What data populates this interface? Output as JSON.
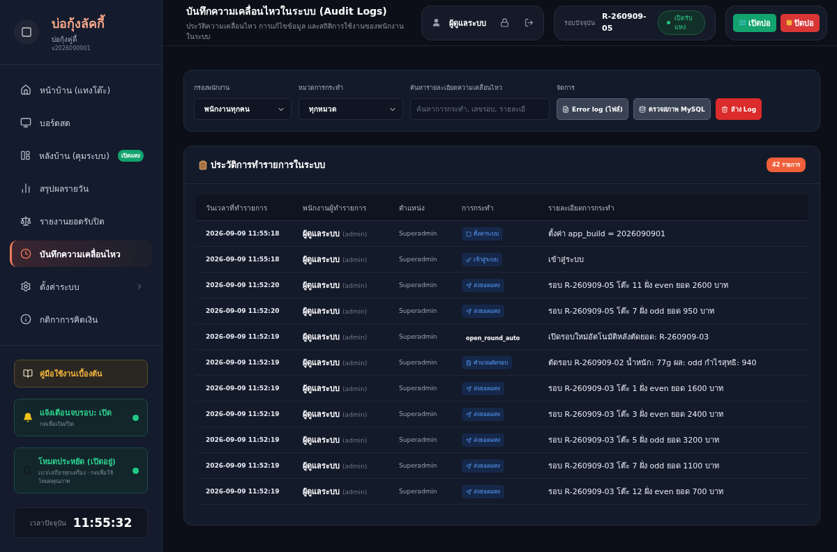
{
  "brand": {
    "name": "บ่อกุ้งลัคกี้",
    "subtitle": "บ่อกุ้งคู่ดี้",
    "version": "v2026090901"
  },
  "nav": [
    {
      "label": "หน้าบ้าน (แทงโต๊ะ)",
      "selected": false
    },
    {
      "label": "บอร์ดสด",
      "selected": false
    },
    {
      "label": "หลังบ้าน (คุมระบบ)",
      "selected": false,
      "badge": "เปิดแทง"
    },
    {
      "label": "สรุปผลรายวัน",
      "selected": false
    },
    {
      "label": "รายงานยอดรับปิด",
      "selected": false
    },
    {
      "label": "บันทึกความเคลื่อนไหว",
      "selected": true
    },
    {
      "label": "ตั้งค่าระบบ",
      "selected": false,
      "expandable": true
    },
    {
      "label": "กติกาการคิดเงิน",
      "selected": false
    }
  ],
  "side_cards": [
    {
      "kind": "guide",
      "title": "คู่มือใช้งานเบื้องต้น"
    },
    {
      "kind": "toggle",
      "title": "แจ้งเตือนจบรอบ: เปิด",
      "hint": "กดเพื่อเปิด/ปิด",
      "on": true
    },
    {
      "kind": "toggle",
      "title": "โหมดประหยัด (เปิดอยู่)",
      "hint": "เบา/เสถียรทุกเครื่อง · กดเพื่อใช้โหมดคุณภาพ",
      "on": true
    }
  ],
  "clock": {
    "label": "เวลาปัจจุบัน",
    "time": "11:55:32"
  },
  "header": {
    "title": "บันทึกความเคลื่อนไหวในระบบ (Audit Logs)",
    "subtitle": "ประวัติความเคลื่อนไหว การแก้ไขข้อมูล และสถิติการใช้งานของพนักงานในระบบ"
  },
  "user": {
    "name": "ผู้ดูแลระบบ"
  },
  "round": {
    "label": "รอบปัจจุบัน",
    "code": "R-260909-05",
    "status": "เปิดรับแทง"
  },
  "pond_buttons": [
    {
      "label": "เปิดบ่อ",
      "kind": "open"
    },
    {
      "label": "ปิดบ่อ",
      "kind": "close"
    }
  ],
  "filters": {
    "staff": {
      "label": "กรองพนักงาน",
      "value": "พนักงานทุกคน"
    },
    "category": {
      "label": "หมวดการกระทำ",
      "value": "ทุกหมวด"
    },
    "search": {
      "label": "ค้นหารายละเอียดความเคลื่อนไหว",
      "placeholder": "ค้นหาการกระทำ, เลขรอบ, รายละเอี"
    },
    "manage": {
      "label": "จัดการ",
      "buttons": [
        {
          "label": "Error log (ไฟล์)",
          "kind": "neutral"
        },
        {
          "label": "ตรวจสภาพ MySQL",
          "kind": "neutral"
        },
        {
          "label": "ล้าง Log",
          "kind": "danger"
        }
      ]
    }
  },
  "table": {
    "title": "ประวัติการทำรายการในระบบ",
    "count": "42 รายการ",
    "columns": [
      "วันเวลาที่ทำรายการ",
      "พนักงานผู้ทำรายการ",
      "ตำแหน่ง",
      "การกระทำ",
      "รายละเอียดการกระทำ"
    ],
    "rows": [
      {
        "time": "2026-09-09 11:55:18",
        "user": "ผู้ดูแลระบบ",
        "username": "(admin)",
        "role": "Superadmin",
        "action": "ตั้งค่าระบบ",
        "kind": "tag",
        "detail": "ตั้งค่า app_build = 2026090901"
      },
      {
        "time": "2026-09-09 11:55:18",
        "user": "ผู้ดูแลระบบ",
        "username": "(admin)",
        "role": "Superadmin",
        "action": "เข้าสู่ระบบ",
        "kind": "tag",
        "detail": "เข้าสู่ระบบ"
      },
      {
        "time": "2026-09-09 11:52:20",
        "user": "ผู้ดูแลระบบ",
        "username": "(admin)",
        "role": "Superadmin",
        "action": "ส่งยอดแทง",
        "kind": "tag",
        "detail": "รอบ R-260909-05 โต๊ะ 11 ฝั่ง even ยอด 2600 บาท"
      },
      {
        "time": "2026-09-09 11:52:20",
        "user": "ผู้ดูแลระบบ",
        "username": "(admin)",
        "role": "Superadmin",
        "action": "ส่งยอดแทง",
        "kind": "tag",
        "detail": "รอบ R-260909-05 โต๊ะ 7 ฝั่ง odd ยอด 950 บาท"
      },
      {
        "time": "2026-09-09 11:52:19",
        "user": "ผู้ดูแลระบบ",
        "username": "(admin)",
        "role": "Superadmin",
        "action": "open_round_auto",
        "kind": "plain",
        "detail": "เปิดรอบใหม่อัตโนมัติหลังตัดยอด: R-260909-03"
      },
      {
        "time": "2026-09-09 11:52:19",
        "user": "ผู้ดูแลระบบ",
        "username": "(admin)",
        "role": "Superadmin",
        "action": "คำนวณตัดรอบ",
        "kind": "tag",
        "detail": "ตัดรอบ R-260909-02 น้ำหนัก: 77g ผล: odd กำไรสุทธิ: 940"
      },
      {
        "time": "2026-09-09 11:52:19",
        "user": "ผู้ดูแลระบบ",
        "username": "(admin)",
        "role": "Superadmin",
        "action": "ส่งยอดแทง",
        "kind": "tag",
        "detail": "รอบ R-260909-03 โต๊ะ 1 ฝั่ง even ยอด 1600 บาท"
      },
      {
        "time": "2026-09-09 11:52:19",
        "user": "ผู้ดูแลระบบ",
        "username": "(admin)",
        "role": "Superadmin",
        "action": "ส่งยอดแทง",
        "kind": "tag",
        "detail": "รอบ R-260909-03 โต๊ะ 3 ฝั่ง even ยอด 2400 บาท"
      },
      {
        "time": "2026-09-09 11:52:19",
        "user": "ผู้ดูแลระบบ",
        "username": "(admin)",
        "role": "Superadmin",
        "action": "ส่งยอดแทง",
        "kind": "tag",
        "detail": "รอบ R-260909-03 โต๊ะ 5 ฝั่ง odd ยอด 3200 บาท"
      },
      {
        "time": "2026-09-09 11:52:19",
        "user": "ผู้ดูแลระบบ",
        "username": "(admin)",
        "role": "Superadmin",
        "action": "ส่งยอดแทง",
        "kind": "tag",
        "detail": "รอบ R-260909-03 โต๊ะ 7 ฝั่ง odd ยอด 1100 บาท"
      },
      {
        "time": "2026-09-09 11:52:19",
        "user": "ผู้ดูแลระบบ",
        "username": "(admin)",
        "role": "Superadmin",
        "action": "ส่งยอดแทง",
        "kind": "tag",
        "detail": "รอบ R-260909-03 โต๊ะ 12 ฝั่ง even ยอด 700 บาท"
      }
    ]
  }
}
